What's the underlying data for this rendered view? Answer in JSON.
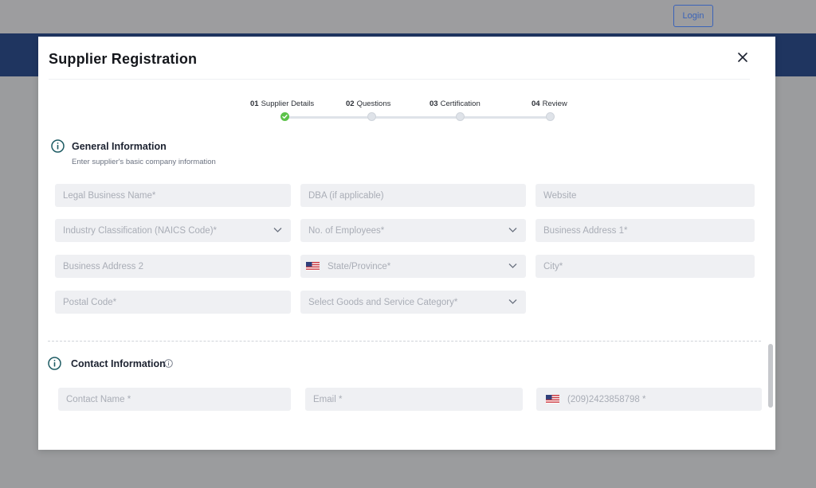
{
  "page": {
    "login_label": "Login"
  },
  "modal": {
    "title": "Supplier Registration",
    "close_icon": "close-icon"
  },
  "stepper": {
    "steps": [
      {
        "num": "01",
        "label": "Supplier Details",
        "done": true
      },
      {
        "num": "02",
        "label": "Questions",
        "done": false
      },
      {
        "num": "03",
        "label": "Certification",
        "done": false
      },
      {
        "num": "04",
        "label": "Review",
        "done": false
      }
    ],
    "done_color": "#5cc24a"
  },
  "general": {
    "title": "General Information",
    "subtitle": "Enter supplier's basic company information",
    "icon": "info-icon",
    "fields": {
      "legal_name": "Legal Business Name*",
      "dba": "DBA (if applicable)",
      "website": "Website",
      "naics": "Industry Classification (NAICS Code)*",
      "employees": "No. of Employees*",
      "address1": "Business Address 1*",
      "address2": "Business Address 2",
      "state": "State/Province*",
      "city": "City*",
      "postal": "Postal Code*",
      "category": "Select Goods and Service Category*"
    }
  },
  "contact": {
    "title": "Contact Information",
    "icon": "info-icon",
    "fields": {
      "name": "Contact Name *",
      "email": "Email *",
      "phone": "(209)2423858798 *"
    }
  },
  "colors": {
    "brand_band": "#1f3560",
    "accent_teal": "#1d5b63",
    "field_bg": "#eff0f3"
  }
}
